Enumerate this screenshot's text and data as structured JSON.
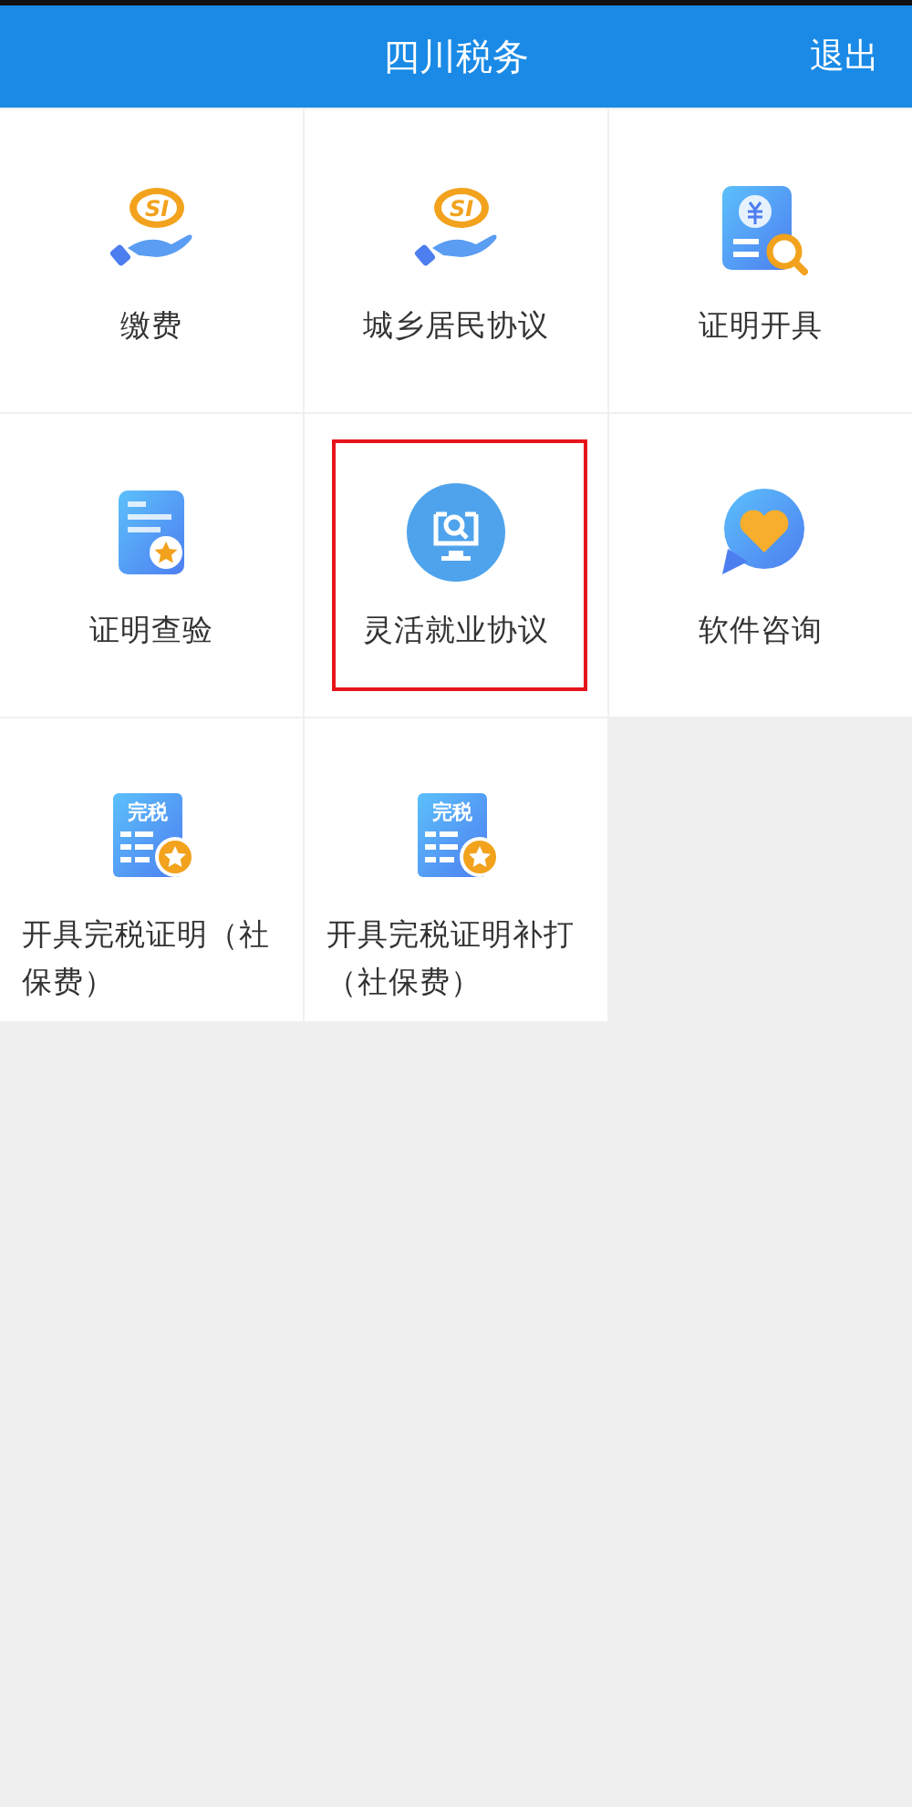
{
  "header": {
    "title": "四川税务",
    "action": "退出"
  },
  "services": [
    {
      "label": "缴费",
      "kind": "si-hand",
      "icon_text": "SI",
      "highlighted": false
    },
    {
      "label": "城乡居民协议",
      "kind": "si-hand",
      "icon_text": "SI",
      "highlighted": false
    },
    {
      "label": "证明开具",
      "kind": "yuan-doc-search",
      "highlighted": false
    },
    {
      "label": "证明查验",
      "kind": "doc-star",
      "highlighted": false
    },
    {
      "label": "灵活就业协议",
      "kind": "monitor-search",
      "highlighted": true
    },
    {
      "label": "软件咨询",
      "kind": "chat-heart",
      "highlighted": false
    },
    {
      "label": "开具完税证明（社保费）",
      "kind": "tax-cert",
      "icon_text": "完税",
      "highlighted": false
    },
    {
      "label": "开具完税证明补打（社保费）",
      "kind": "tax-cert",
      "icon_text": "完税",
      "highlighted": false
    }
  ]
}
